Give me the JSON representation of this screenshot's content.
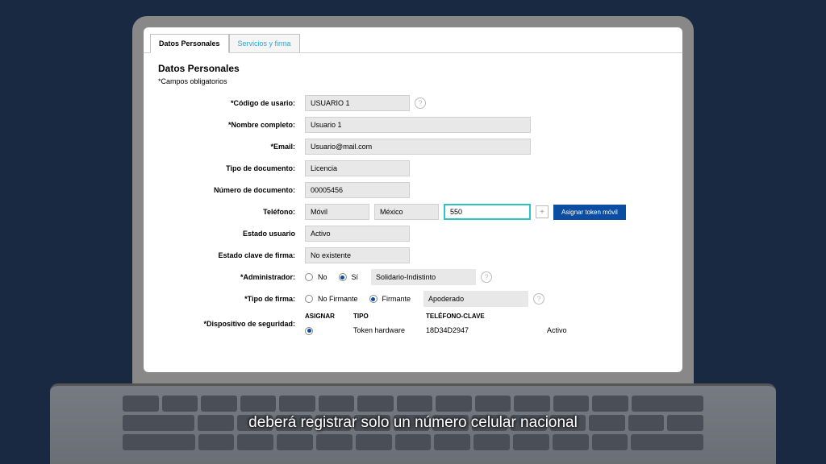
{
  "tabs": {
    "personal": "Datos Personales",
    "services": "Servicios y firma"
  },
  "section": {
    "title": "Datos Personales",
    "required_note": "*Campos obligatorios"
  },
  "form": {
    "user_code": {
      "label": "*Código de usario:",
      "value": "USUARIO 1"
    },
    "full_name": {
      "label": "*Nombre completo:",
      "value": "Usuario 1"
    },
    "email": {
      "label": "*Email:",
      "value": "Usuario@mail.com"
    },
    "doc_type": {
      "label": "Tipo de documento:",
      "value": "Licencia"
    },
    "doc_number": {
      "label": "Número de documento:",
      "value": "00005456"
    },
    "phone": {
      "label": "Teléfono:",
      "type": "Móvil",
      "country": "México",
      "number": "550"
    },
    "assign_token_btn": "Asignar token móvil",
    "user_status": {
      "label": "Estado usuario",
      "value": "Activo"
    },
    "sign_key_status": {
      "label": "Estado clave de firma:",
      "value": "No existente"
    },
    "admin": {
      "label": "*Administrador:",
      "no": "No",
      "yes": "Sí",
      "dropdown": "Solidario-Indistinto"
    },
    "sign_type": {
      "label": "*Tipo de firma:",
      "no": "No Firmante",
      "yes": "Firmante",
      "dropdown": "Apoderado"
    },
    "security_device": {
      "label": "*Dispositivo de seguridad:"
    },
    "device_table": {
      "headers": {
        "assign": "ASIGNAR",
        "type": "TIPO",
        "phone": "TELÉFONO-CLAVE"
      },
      "row": {
        "type": "Token hardware",
        "phone": "18D34D2947",
        "status": "Activo"
      }
    }
  },
  "caption": "deberá registrar solo un número celular nacional"
}
